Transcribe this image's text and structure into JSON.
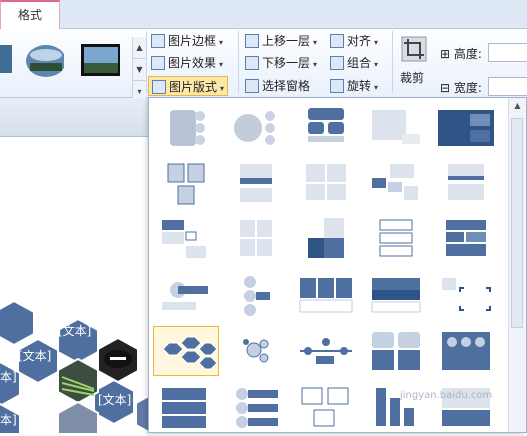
{
  "tabs": {
    "format": "格式"
  },
  "ribbon": {
    "picture_border": "图片边框",
    "picture_effects": "图片效果",
    "picture_layout": "图片版式",
    "bring_forward": "上移一层",
    "send_backward": "下移一层",
    "selection_pane": "选择窗格",
    "align": "对齐",
    "group": "组合",
    "rotate": "旋转",
    "crop": "裁剪",
    "height_label": "高度:",
    "width_label": "宽度:"
  },
  "canvas": {
    "hex_labels": [
      "[文本]",
      "[文本]",
      "[文本]",
      "本]",
      "本]",
      "[文本]"
    ]
  },
  "layout_gallery": {
    "item_count": 42,
    "selected_index": 28
  },
  "watermark": "jingyan.baidu.com",
  "colors": {
    "accent": "#4f6fa0",
    "dark": "#2f4f7f",
    "light": "#c5d1e2",
    "selected_border": "#f0b63a"
  }
}
